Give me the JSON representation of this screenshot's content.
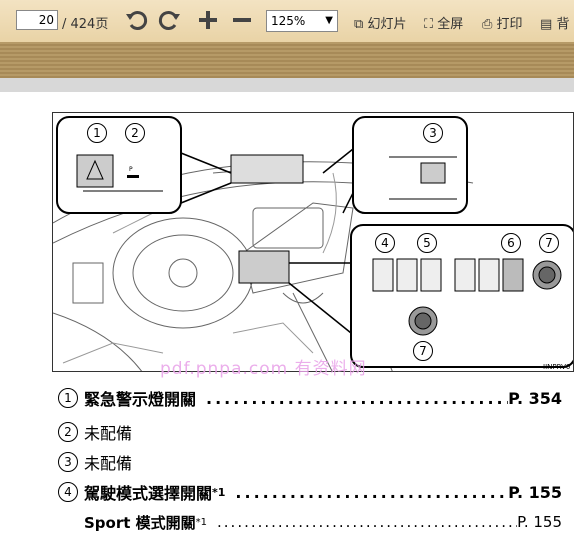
{
  "toolbar": {
    "page_value": "20",
    "page_total": "/ 424页",
    "zoom": "125%",
    "slideshow": "幻灯片",
    "fullscreen": "全屏",
    "print": "打印",
    "background": "背"
  },
  "figure": {
    "code": "IINPRV0",
    "callouts": [
      "1",
      "2",
      "3",
      "4",
      "5",
      "6",
      "7",
      "7"
    ]
  },
  "watermark": "pdf.pnpa.com 有资料网",
  "items": [
    {
      "num": "1",
      "label": "緊急警示燈開關",
      "sup": "",
      "page": "P. 354",
      "bold": true
    },
    {
      "num": "2",
      "label": "未配備",
      "sup": "",
      "page": "",
      "bold": false
    },
    {
      "num": "3",
      "label": "未配備",
      "sup": "",
      "page": "",
      "bold": false
    },
    {
      "num": "4",
      "label": "駕駛模式選擇開關 ",
      "sup": "*1",
      "page": "P. 155",
      "bold": true
    },
    {
      "num": "",
      "label": "Sport 模式開關 ",
      "sup": "*1",
      "page": "P. 155",
      "bold": false
    }
  ]
}
